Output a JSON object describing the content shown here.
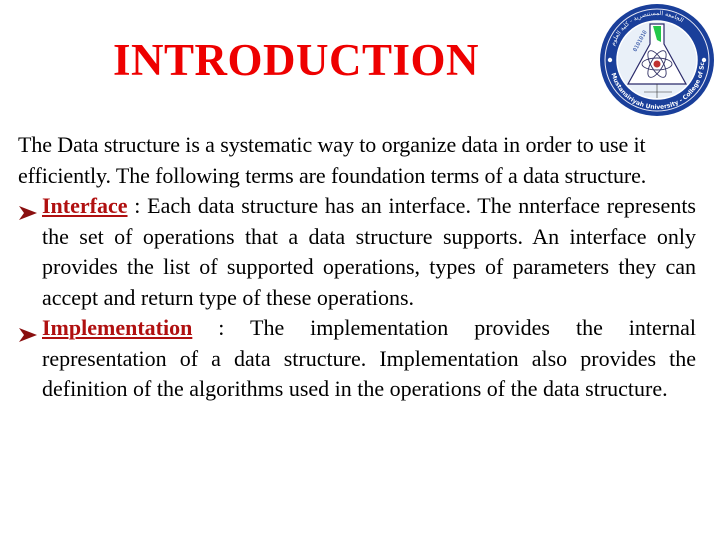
{
  "slide": {
    "title": "INTRODUCTION",
    "title_color": "#ee0000",
    "term_color": "#b01010",
    "logo": {
      "icon": "university-seal-icon",
      "outer_text": "Mustansiriyah University - College of Science",
      "inner_digits": "0101010"
    },
    "intro_paragraph": "The Data structure is a systematic way to organize data in order to use it efficiently. The following terms are foundation terms of a data structure.",
    "bullets": [
      {
        "icon": "arrow-bullet-icon",
        "term": "Interface",
        "separator": " : ",
        "text": "Each data structure has an interface. The nnterface represents the set of operations that a data structure supports. An interface only provides the list of supported operations, types of parameters they can accept and return type of these operations."
      },
      {
        "icon": "arrow-bullet-icon",
        "term": "Implementation",
        "separator": " : ",
        "text": "The implementation provides the internal representation of a data structure. Implementation also provides the definition of the algorithms used in the operations of the data structure."
      }
    ]
  }
}
